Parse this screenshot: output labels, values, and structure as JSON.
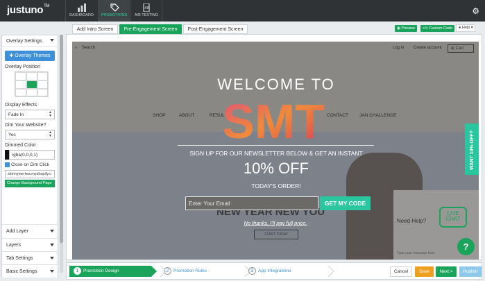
{
  "app": {
    "logo": "justuno",
    "logo_tm": "TM"
  },
  "nav": {
    "items": [
      {
        "label": "DASHBOARD",
        "icon": "bar-chart-icon"
      },
      {
        "label": "PROMOTIONS",
        "icon": "tag-icon"
      },
      {
        "label": "A/B TESTING",
        "icon": "ab-flask-icon"
      }
    ],
    "active": "PROMOTIONS"
  },
  "tabs": [
    "Add Intro Screen",
    "Pre-Engagement Screen",
    "Post-Engagement Screen"
  ],
  "active_tab": "Pre-Engagement Screen",
  "toolbar": {
    "preview": "Preview",
    "custom_code": "Custom Code",
    "help": "Help"
  },
  "left_panel": {
    "header": "Overlay Settings",
    "overlay_themes_button": "Overlay Themes",
    "overlay_position_label": "Overlay Position",
    "overlay_position_selected": "center",
    "display_effects_label": "Display Effects",
    "display_effects_value": "Fade In",
    "dim_label": "Dim Your Website?",
    "dim_value": "Yes",
    "dimmed_color_label": "Dimmed Color",
    "dimmed_color_value": "rgba(0,0,0,1)",
    "close_on_dim_label": "Close on Dim Click",
    "close_on_dim_checked": true,
    "url_value": "skinnyme-tea.myshopify.c",
    "change_bg_button": "Change Background Page",
    "sections": [
      "Add Layer",
      "Layers",
      "Tab Settings",
      "Basic Settings"
    ]
  },
  "site": {
    "search": "Search",
    "login": "Log in",
    "create_account": "Create account",
    "cart": "Cart",
    "menu": [
      "SHOP",
      "ABOUT",
      "RESUL",
      "CONTACT",
      "JAN CHALLENGE"
    ],
    "hero_title": "NEW YEAR NEW YOU",
    "hero_button": "START TODAY",
    "help_text": "Need Help?",
    "chat_text": "LIVE CHAT",
    "chat_input_placeholder": "Type your message here"
  },
  "popup": {
    "welcome": "WELCOME TO",
    "brand": "SMT",
    "signup": "SIGN UP FOR OUR NEWSLETTER BELOW & GET AN INSTANT",
    "discount": "10% OFF",
    "today": "TODAY'S ORDER!",
    "email_placeholder": "Enter Your Email",
    "cta": "GET MY CODE",
    "decline": "No thanks, I'll pay full price."
  },
  "side_tab": "WANT 10% OFF?",
  "help_circle": "?",
  "steps": [
    {
      "num": "1",
      "label": "Promotion Design"
    },
    {
      "num": "2",
      "label": "Promotion Rules"
    },
    {
      "num": "3",
      "label": "App Integrations"
    }
  ],
  "bottom_buttons": {
    "cancel": "Cancel",
    "save": "Save",
    "next": "Next >",
    "publish": "Publish"
  },
  "colors": {
    "brand_green": "#1aa35a",
    "accent_teal": "#29c6a0",
    "topbar": "#2f3336",
    "blue": "#3c8fd8",
    "save_orange": "#f0a020"
  }
}
